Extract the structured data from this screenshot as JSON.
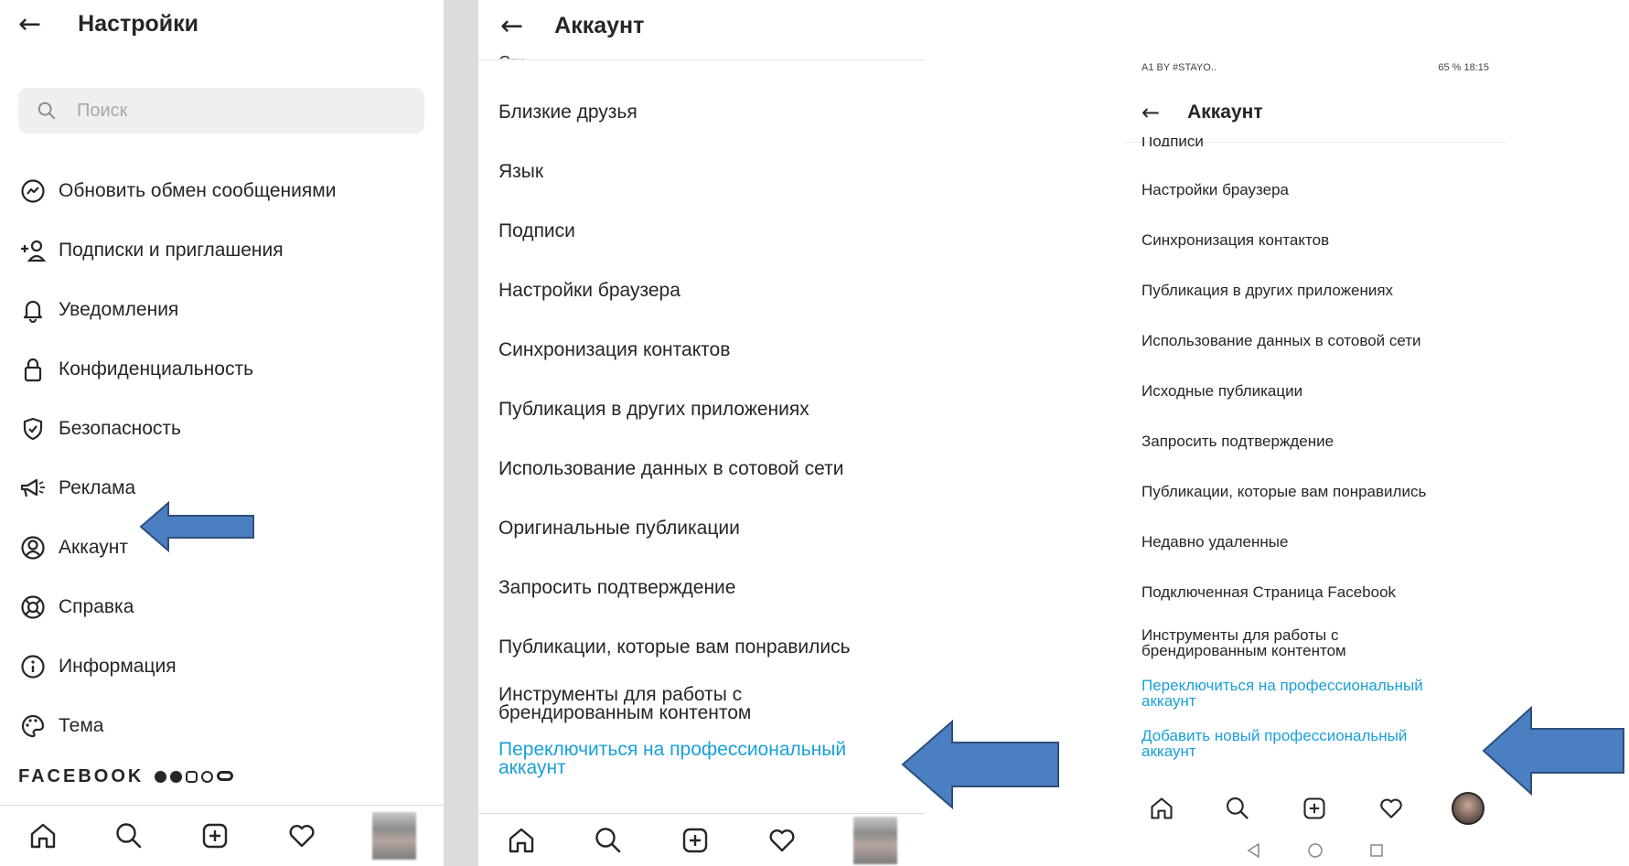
{
  "panel1": {
    "title": "Настройки",
    "search_placeholder": "Поиск",
    "items": [
      {
        "icon": "messenger-icon",
        "label": "Обновить обмен сообщениями"
      },
      {
        "icon": "add-person-icon",
        "label": "Подписки и приглашения"
      },
      {
        "icon": "bell-icon",
        "label": "Уведомления"
      },
      {
        "icon": "lock-icon",
        "label": "Конфиденциальность"
      },
      {
        "icon": "shield-icon",
        "label": "Безопасность"
      },
      {
        "icon": "megaphone-icon",
        "label": "Реклама"
      },
      {
        "icon": "user-circle-icon",
        "label": "Аккаунт"
      },
      {
        "icon": "lifebuoy-icon",
        "label": "Справка"
      },
      {
        "icon": "info-icon",
        "label": "Информация"
      },
      {
        "icon": "palette-icon",
        "label": "Тема"
      }
    ],
    "facebook_label": "FACEBOOK"
  },
  "panel2": {
    "title": "Аккаунт",
    "cut_item": "Стр...",
    "items": [
      "Близкие друзья",
      "Язык",
      "Подписи",
      "Настройки браузера",
      "Синхронизация контактов",
      "Публикация в других приложениях",
      "Использование данных в сотовой сети",
      "Оригинальные публикации",
      "Запросить подтверждение",
      "Публикации, которые вам понравились"
    ],
    "branded_tools": "Инструменты для работы с брендированным контентом",
    "switch_pro": "Переключиться на профессиональный аккаунт"
  },
  "panel3": {
    "status_left": "A1 BY #STAYO..",
    "status_right": "65 %  18:15",
    "title": "Аккаунт",
    "cut_item": "Подписи",
    "items": [
      "Настройки браузера",
      "Синхронизация контактов",
      "Публикация в других приложениях",
      "Использование данных в сотовой сети",
      "Исходные публикации",
      "Запросить подтверждение",
      "Публикации, которые вам понравились",
      "Недавно удаленные",
      "Подключенная Страница Facebook"
    ],
    "branded_tools": "Инструменты для работы с брендированным контентом",
    "switch_pro": "Переключиться на профессиональный аккаунт",
    "add_pro": "Добавить новый профессиональный аккаунт"
  },
  "colors": {
    "link_blue": "#1a9fd9",
    "arrow_blue": "#4a7fc1",
    "arrow_border": "#2f4f7a"
  }
}
